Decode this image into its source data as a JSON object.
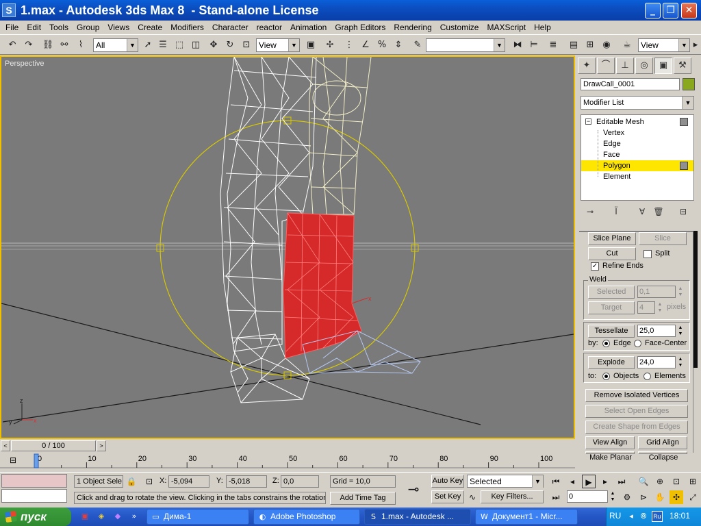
{
  "window": {
    "title": "1.max - Autodesk 3ds Max 8  - Stand-alone License",
    "minimize_icon": "minimize-icon",
    "restore_icon": "restore-icon",
    "close_icon": "close-icon"
  },
  "menu": [
    "File",
    "Edit",
    "Tools",
    "Group",
    "Views",
    "Create",
    "Modifiers",
    "Character",
    "reactor",
    "Animation",
    "Graph Editors",
    "Rendering",
    "Customize",
    "MAXScript",
    "Help"
  ],
  "toolbar": {
    "selection_filter": "All",
    "ref_coord_1": "View",
    "named_selection": "",
    "ref_coord_2": "View"
  },
  "viewport": {
    "label": "Perspective",
    "axis_x": "x",
    "axis_y": "y",
    "axis_z": "z",
    "selection_color": "#d62a2a",
    "active_border_color": "#f0c000"
  },
  "command_panel": {
    "object_name": "DrawCall_0001",
    "object_color": "#8aa81e",
    "modifier_list": "Modifier List",
    "stack": {
      "root": "Editable Mesh",
      "items": [
        "Vertex",
        "Edge",
        "Face",
        "Polygon",
        "Element"
      ],
      "selected": "Polygon"
    },
    "slice_plane": "Slice Plane",
    "slice": "Slice",
    "cut": "Cut",
    "split": "Split",
    "refine_ends": "Refine Ends",
    "weld": {
      "title": "Weld",
      "selected_btn": "Selected",
      "selected_val": "0,1",
      "target_btn": "Target",
      "target_val": "4",
      "pixels": "pixels"
    },
    "tessellate": {
      "btn": "Tessellate",
      "val": "25,0",
      "by": "by:",
      "edge": "Edge",
      "face_center": "Face-Center"
    },
    "explode": {
      "btn": "Explode",
      "val": "24,0",
      "to": "to:",
      "objects": "Objects",
      "elements": "Elements"
    },
    "remove_isolated": "Remove Isolated Vertices",
    "select_open_edges": "Select Open Edges",
    "create_shape": "Create Shape from Edges",
    "view_align": "View Align",
    "grid_align": "Grid Align",
    "make_planar": "Make Planar",
    "collapse": "Collapse"
  },
  "timeslider": {
    "frame": "0 / 100",
    "prev": "<",
    "next": ">",
    "ticks": [
      "0",
      "10",
      "20",
      "30",
      "40",
      "50",
      "60",
      "70",
      "80",
      "90",
      "100"
    ]
  },
  "status": {
    "selection": "1 Object Sele",
    "x_label": "X:",
    "x_val": "-5,094",
    "y_label": "Y:",
    "y_val": "-5,018",
    "z_label": "Z:",
    "z_val": "0,0",
    "grid": "Grid = 10,0",
    "prompt": "Click and drag to rotate the view.  Clicking in the tabs constrains the rotation",
    "add_time_tag": "Add Time Tag",
    "auto_key": "Auto Key",
    "set_key": "Set Key",
    "key_mode": "Selected",
    "key_filters": "Key Filters...",
    "current_frame": "0"
  },
  "taskbar": {
    "start": "пуск",
    "tasks": [
      "Дима-1",
      "Adobe Photoshop",
      "1.max - Autodesk ...",
      "Документ1 - Micr..."
    ],
    "lang": "RU",
    "lang_badge": "Ru",
    "clock": "18:01",
    "more": "»"
  }
}
